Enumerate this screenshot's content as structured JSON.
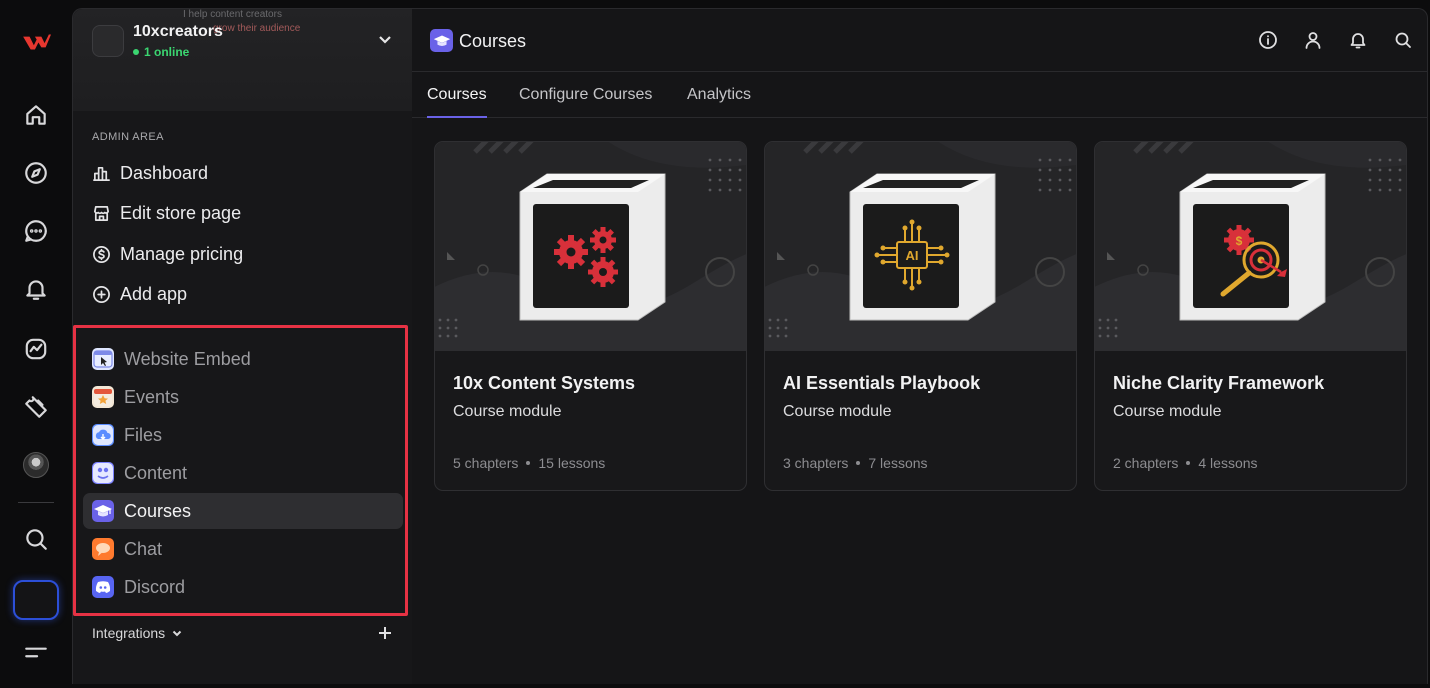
{
  "store": {
    "name": "10xcreators",
    "online": "1 online",
    "tagline_1": "I help content creators",
    "tagline_2": "grow their audience"
  },
  "sidebar": {
    "section_label": "ADMIN AREA",
    "admin_items": [
      {
        "label": "Dashboard",
        "icon": "chart-bar-icon"
      },
      {
        "label": "Edit store page",
        "icon": "storefront-icon"
      },
      {
        "label": "Manage pricing",
        "icon": "dollar-circle-icon"
      },
      {
        "label": "Add app",
        "icon": "plus-circle-icon"
      }
    ],
    "apps": [
      {
        "label": "Website Embed",
        "icon": "website-embed-icon",
        "color": "#dfe6ff",
        "active": false
      },
      {
        "label": "Events",
        "icon": "events-icon",
        "color": "#f3e7d6",
        "active": false
      },
      {
        "label": "Files",
        "icon": "files-icon",
        "color": "#5b8dff",
        "active": false
      },
      {
        "label": "Content",
        "icon": "content-icon",
        "color": "#7c82ff",
        "active": false
      },
      {
        "label": "Courses",
        "icon": "courses-icon",
        "color": "#6a62e8",
        "active": true
      },
      {
        "label": "Chat",
        "icon": "chat-icon",
        "color": "#ff7a2e",
        "active": false
      },
      {
        "label": "Discord",
        "icon": "discord-icon",
        "color": "#5865f2",
        "active": false
      }
    ],
    "integrations_label": "Integrations"
  },
  "header": {
    "title": "Courses",
    "icons": [
      "info-icon",
      "user-icon",
      "bell-icon",
      "search-icon"
    ]
  },
  "tabs": [
    {
      "label": "Courses",
      "active": true
    },
    {
      "label": "Configure Courses",
      "active": false
    },
    {
      "label": "Analytics",
      "active": false
    }
  ],
  "courses": [
    {
      "title": "10x Content Systems",
      "subtitle": "Course module",
      "chapters": "5 chapters",
      "lessons": "15 lessons",
      "art": "gears"
    },
    {
      "title": "AI Essentials Playbook",
      "subtitle": "Course module",
      "chapters": "3 chapters",
      "lessons": "7 lessons",
      "art": "ai-chip"
    },
    {
      "title": "Niche Clarity Framework",
      "subtitle": "Course module",
      "chapters": "2 chapters",
      "lessons": "4 lessons",
      "art": "target"
    }
  ],
  "ai_chip_text": "AI",
  "colors": {
    "accent": "#6a62e8",
    "highlight": "#e63244",
    "online": "#3bd671",
    "gear_red": "#d8303a",
    "chip_gold": "#e0a82e"
  }
}
